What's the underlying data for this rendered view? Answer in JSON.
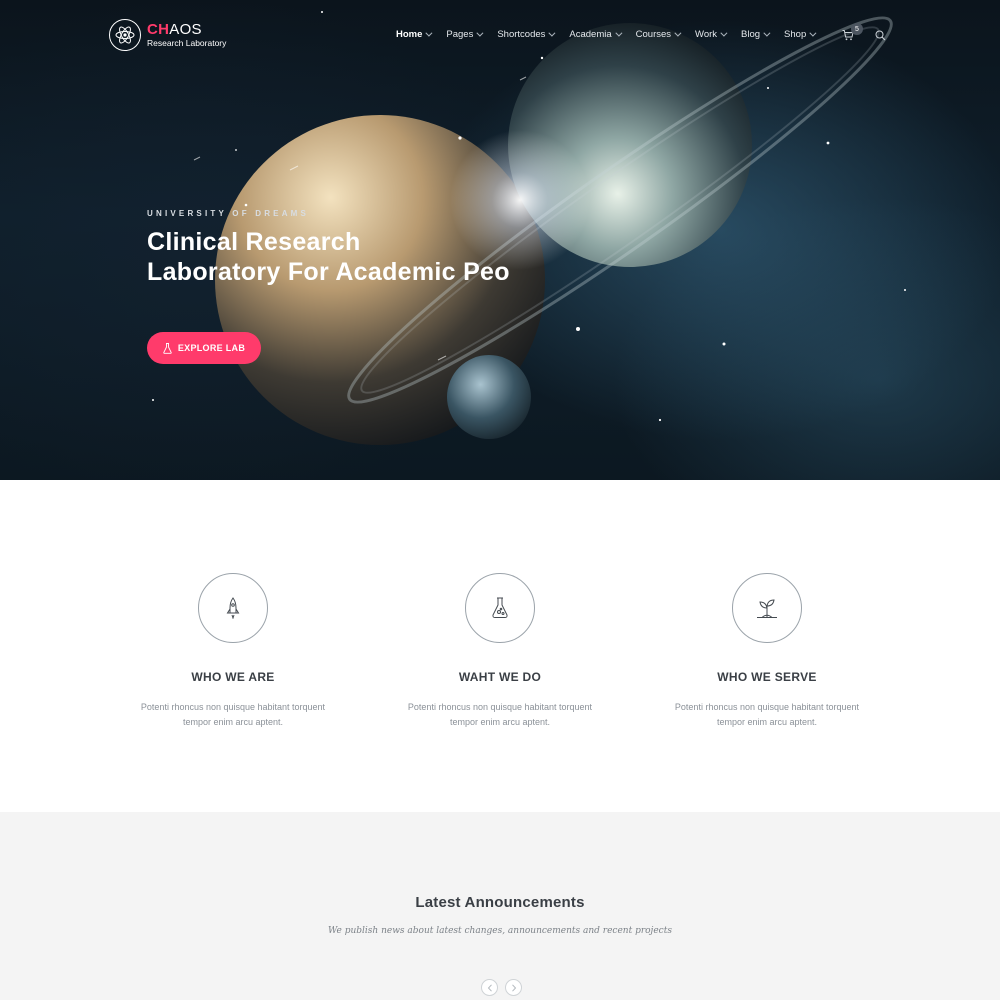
{
  "brand": {
    "name_accent": "CH",
    "name_rest": "AOS",
    "tagline": "Research Laboratory",
    "accent_color": "#ff3b6b"
  },
  "nav": {
    "items": [
      {
        "label": "Home",
        "active": true
      },
      {
        "label": "Pages"
      },
      {
        "label": "Shortcodes"
      },
      {
        "label": "Academia"
      },
      {
        "label": "Courses"
      },
      {
        "label": "Work"
      },
      {
        "label": "Blog"
      },
      {
        "label": "Shop"
      }
    ],
    "cart_count": "5",
    "cart_icon": "cart-icon",
    "search_icon": "search-icon"
  },
  "hero": {
    "eyebrow": "UNIVERSITY OF DREAMS",
    "headline_line1": "Clinical Research",
    "headline_line2": "Laboratory For Academic Peo",
    "cta_label": "EXPLORE LAB",
    "cta_icon": "flask-icon"
  },
  "features": [
    {
      "icon": "rocket-icon",
      "title": "WHO WE ARE",
      "text": "Potenti rhoncus non quisque habitant torquent tempor enim arcu aptent."
    },
    {
      "icon": "flask-icon",
      "title": "WAHT WE DO",
      "text": "Potenti rhoncus non quisque habitant torquent tempor enim arcu aptent."
    },
    {
      "icon": "sprout-icon",
      "title": "WHO WE SERVE",
      "text": "Potenti rhoncus non quisque habitant torquent tempor enim arcu aptent."
    }
  ],
  "announcements": {
    "title": "Latest Announcements",
    "subtitle": "We publish news about latest changes, announcements and recent projects",
    "prev_icon": "chevron-left-icon",
    "next_icon": "chevron-right-icon"
  }
}
